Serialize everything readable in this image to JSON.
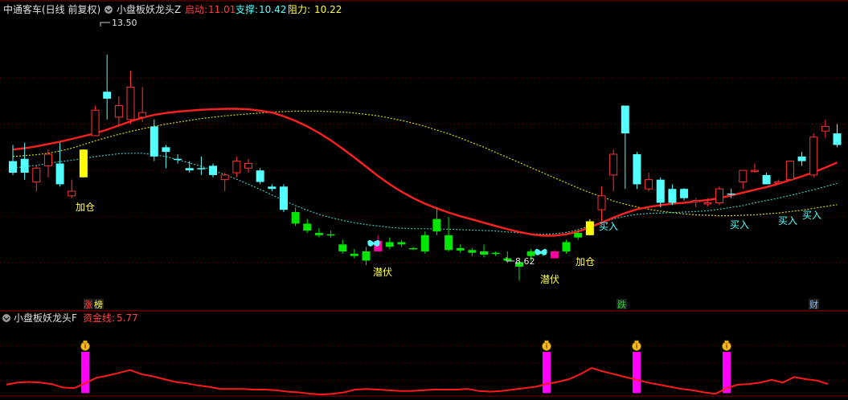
{
  "header": {
    "stock_name": "中通客车(日线 前复权)",
    "indicator_name": "小盘板妖龙头Z",
    "start_label": "启动:",
    "start_value": "11.01",
    "support_label": "支撑:",
    "support_value": "10.42",
    "resistance_label": "阻力:",
    "resistance_value": "10.22"
  },
  "lower_header": {
    "indicator_name": "小盘板妖龙头F",
    "capital_label": "资金线:",
    "capital_value": "5.77"
  },
  "markers": {
    "high_label": "13.50",
    "low_label": "8.62",
    "tag_zhangting_1": "涨",
    "tag_zhangting_2": "榜",
    "tag_die": "跌",
    "tag_cai": "财"
  },
  "signals": {
    "jiacang_1": "加仓",
    "jiacang_2": "加仓",
    "qianfu_1": "潜伏",
    "qianfu_2": "潜伏",
    "mairu_1": "买入",
    "mairu_2": "买入",
    "mairu_3": "买入",
    "mairu_4": "买入"
  },
  "colors": {
    "background": "#000000",
    "up": "#ff3232",
    "down_cyan": "#54ffff",
    "down_green": "#00e600",
    "signal_yellow": "#ffff00",
    "signal_magenta": "#ff00a0",
    "ma_red": "#ff2020",
    "ma_yellow_dotted": "#d8d800",
    "ma_cyan_dotted": "#40c0c0",
    "capital_line": "#ff1a1a",
    "capital_bar": "#ff00ff",
    "grid": "#800000",
    "label_yellow": "#ffff40",
    "label_cyan": "#54ffff"
  },
  "chart_data": [
    {
      "type": "candlestick",
      "title": "小盘板妖龙头Z",
      "ylim": [
        8.0,
        14.3
      ],
      "candles": [
        {
          "o": 11.2,
          "h": 11.55,
          "l": 10.9,
          "c": 10.95,
          "s": "cyan"
        },
        {
          "o": 10.95,
          "h": 11.6,
          "l": 10.8,
          "c": 11.25,
          "s": "cyan"
        },
        {
          "o": 10.75,
          "h": 11.1,
          "l": 10.55,
          "c": 11.05,
          "s": "red"
        },
        {
          "o": 11.1,
          "h": 11.45,
          "l": 10.85,
          "c": 11.35,
          "s": "red"
        },
        {
          "o": 11.15,
          "h": 11.6,
          "l": 10.65,
          "c": 10.7,
          "s": "cyan"
        },
        {
          "o": 10.55,
          "h": 10.8,
          "l": 10.4,
          "c": 10.45,
          "s": "red"
        },
        {
          "o": 10.85,
          "h": 11.45,
          "l": 10.85,
          "c": 11.45,
          "s": "yellow"
        },
        {
          "o": 11.75,
          "h": 12.4,
          "l": 11.75,
          "c": 12.3,
          "s": "red"
        },
        {
          "o": 12.7,
          "h": 13.5,
          "l": 12.1,
          "c": 12.55,
          "s": "cyan"
        },
        {
          "o": 12.15,
          "h": 12.6,
          "l": 11.95,
          "c": 12.4,
          "s": "red"
        },
        {
          "o": 12.1,
          "h": 13.15,
          "l": 12.0,
          "c": 12.8,
          "s": "red"
        },
        {
          "o": 12.15,
          "h": 12.8,
          "l": 12.05,
          "c": 12.25,
          "s": "red"
        },
        {
          "o": 11.95,
          "h": 12.1,
          "l": 11.2,
          "c": 11.3,
          "s": "cyan"
        },
        {
          "o": 11.5,
          "h": 11.55,
          "l": 11.05,
          "c": 11.4,
          "s": "cyan"
        },
        {
          "o": 11.25,
          "h": 11.35,
          "l": 11.15,
          "c": 11.25,
          "s": "cyan"
        },
        {
          "o": 11.05,
          "h": 11.2,
          "l": 10.95,
          "c": 11.0,
          "s": "cyan"
        },
        {
          "o": 11.05,
          "h": 11.3,
          "l": 10.9,
          "c": 11.05,
          "s": "cyan"
        },
        {
          "o": 11.1,
          "h": 11.15,
          "l": 10.85,
          "c": 10.9,
          "s": "cyan"
        },
        {
          "o": 10.8,
          "h": 10.95,
          "l": 10.55,
          "c": 10.9,
          "s": "red"
        },
        {
          "o": 10.95,
          "h": 11.3,
          "l": 10.85,
          "c": 11.2,
          "s": "red"
        },
        {
          "o": 11.05,
          "h": 11.25,
          "l": 10.95,
          "c": 11.15,
          "s": "red"
        },
        {
          "o": 11.0,
          "h": 11.05,
          "l": 10.7,
          "c": 10.75,
          "s": "cyan"
        },
        {
          "o": 10.65,
          "h": 10.7,
          "l": 10.55,
          "c": 10.6,
          "s": "cyan"
        },
        {
          "o": 10.65,
          "h": 10.7,
          "l": 10.1,
          "c": 10.15,
          "s": "cyan"
        },
        {
          "o": 10.1,
          "h": 10.2,
          "l": 9.8,
          "c": 9.85,
          "s": "green"
        },
        {
          "o": 9.85,
          "h": 9.95,
          "l": 9.65,
          "c": 9.7,
          "s": "green"
        },
        {
          "o": 9.65,
          "h": 9.75,
          "l": 9.55,
          "c": 9.6,
          "s": "green"
        },
        {
          "o": 9.6,
          "h": 9.7,
          "l": 9.55,
          "c": 9.62,
          "s": "green"
        },
        {
          "o": 9.4,
          "h": 9.5,
          "l": 9.2,
          "c": 9.25,
          "s": "green"
        },
        {
          "o": 9.2,
          "h": 9.3,
          "l": 9.1,
          "c": 9.15,
          "s": "green"
        },
        {
          "o": 9.25,
          "h": 9.35,
          "l": 8.95,
          "c": 9.05,
          "s": "green"
        },
        {
          "o": 9.25,
          "h": 9.6,
          "l": 9.25,
          "c": 9.48,
          "s": "magenta"
        },
        {
          "o": 9.45,
          "h": 9.55,
          "l": 9.3,
          "c": 9.35,
          "s": "green"
        },
        {
          "o": 9.4,
          "h": 9.5,
          "l": 9.35,
          "c": 9.45,
          "s": "green"
        },
        {
          "o": 9.32,
          "h": 9.35,
          "l": 9.28,
          "c": 9.32,
          "s": "green"
        },
        {
          "o": 9.6,
          "h": 9.68,
          "l": 9.2,
          "c": 9.25,
          "s": "green"
        },
        {
          "o": 9.95,
          "h": 10.2,
          "l": 9.6,
          "c": 9.68,
          "s": "green"
        },
        {
          "o": 9.6,
          "h": 10.0,
          "l": 9.25,
          "c": 9.28,
          "s": "green"
        },
        {
          "o": 9.32,
          "h": 9.4,
          "l": 9.22,
          "c": 9.27,
          "s": "green"
        },
        {
          "o": 9.28,
          "h": 9.32,
          "l": 9.15,
          "c": 9.22,
          "s": "green"
        },
        {
          "o": 9.25,
          "h": 9.4,
          "l": 9.12,
          "c": 9.18,
          "s": "green"
        },
        {
          "o": 9.22,
          "h": 9.25,
          "l": 9.15,
          "c": 9.2,
          "s": "green"
        },
        {
          "o": 9.1,
          "h": 9.25,
          "l": 9.0,
          "c": 9.05,
          "s": "green"
        },
        {
          "o": 9.02,
          "h": 9.05,
          "l": 8.62,
          "c": 8.92,
          "s": "green"
        },
        {
          "o": 9.15,
          "h": 9.3,
          "l": 9.05,
          "c": 9.25,
          "s": "green"
        },
        {
          "o": 9.2,
          "h": 9.28,
          "l": 9.15,
          "c": 9.22,
          "s": "green"
        },
        {
          "o": 9.1,
          "h": 9.28,
          "l": 9.1,
          "c": 9.25,
          "s": "magenta"
        },
        {
          "o": 9.25,
          "h": 9.5,
          "l": 9.2,
          "c": 9.45,
          "s": "green"
        },
        {
          "o": 9.55,
          "h": 9.7,
          "l": 9.5,
          "c": 9.65,
          "s": "green"
        },
        {
          "o": 9.6,
          "h": 9.95,
          "l": 9.6,
          "c": 9.9,
          "s": "yellow"
        },
        {
          "o": 10.15,
          "h": 10.65,
          "l": 9.9,
          "c": 10.45,
          "s": "red"
        },
        {
          "o": 10.9,
          "h": 11.45,
          "l": 10.55,
          "c": 11.35,
          "s": "red"
        },
        {
          "o": 11.8,
          "h": 12.4,
          "l": 10.6,
          "c": 12.4,
          "s": "cyan"
        },
        {
          "o": 11.35,
          "h": 11.4,
          "l": 10.6,
          "c": 10.7,
          "s": "cyan"
        },
        {
          "o": 10.6,
          "h": 10.95,
          "l": 10.55,
          "c": 10.8,
          "s": "red"
        },
        {
          "o": 10.8,
          "h": 10.85,
          "l": 10.2,
          "c": 10.3,
          "s": "cyan"
        },
        {
          "o": 10.6,
          "h": 10.7,
          "l": 10.25,
          "c": 10.3,
          "s": "cyan"
        },
        {
          "o": 10.6,
          "h": 10.62,
          "l": 10.35,
          "c": 10.4,
          "s": "cyan"
        },
        {
          "o": 10.35,
          "h": 10.4,
          "l": 10.2,
          "c": 10.35,
          "s": "red"
        },
        {
          "o": 10.28,
          "h": 10.4,
          "l": 10.22,
          "c": 10.3,
          "s": "red"
        },
        {
          "o": 10.3,
          "h": 10.65,
          "l": 10.25,
          "c": 10.6,
          "s": "red"
        },
        {
          "o": 10.5,
          "h": 10.6,
          "l": 10.4,
          "c": 10.5,
          "s": "cyan"
        },
        {
          "o": 10.75,
          "h": 11.0,
          "l": 10.6,
          "c": 11.0,
          "s": "red"
        },
        {
          "o": 11.0,
          "h": 11.15,
          "l": 10.95,
          "c": 11.0,
          "s": "red"
        },
        {
          "o": 10.7,
          "h": 10.95,
          "l": 10.7,
          "c": 10.9,
          "s": "cyan"
        },
        {
          "o": 10.75,
          "h": 10.8,
          "l": 10.7,
          "c": 10.75,
          "s": "red"
        },
        {
          "o": 10.8,
          "h": 11.2,
          "l": 10.8,
          "c": 11.2,
          "s": "red"
        },
        {
          "o": 11.3,
          "h": 11.4,
          "l": 11.1,
          "c": 11.2,
          "s": "cyan"
        },
        {
          "o": 10.9,
          "h": 11.8,
          "l": 10.85,
          "c": 11.72,
          "s": "red"
        },
        {
          "o": 11.95,
          "h": 12.1,
          "l": 11.7,
          "c": 11.85,
          "s": "red"
        },
        {
          "o": 11.8,
          "h": 12.0,
          "l": 11.5,
          "c": 11.55,
          "s": "cyan"
        }
      ],
      "ma_red": [
        11.45,
        11.48,
        11.52,
        11.57,
        11.62,
        11.68,
        11.74,
        11.8,
        11.88,
        11.97,
        12.06,
        12.14,
        12.2,
        12.24,
        12.27,
        12.29,
        12.31,
        12.32,
        12.33,
        12.33,
        12.32,
        12.29,
        12.25,
        12.17,
        12.07,
        11.95,
        11.81,
        11.65,
        11.47,
        11.28,
        11.08,
        10.88,
        10.7,
        10.54,
        10.4,
        10.28,
        10.18,
        10.09,
        10.01,
        9.94,
        9.87,
        9.8,
        9.73,
        9.67,
        9.62,
        9.59,
        9.59,
        9.62,
        9.68,
        9.77,
        9.87,
        9.98,
        10.08,
        10.16,
        10.21,
        10.25,
        10.28,
        10.3,
        10.33,
        10.36,
        10.4,
        10.46,
        10.52,
        10.58,
        10.64,
        10.71,
        10.79,
        10.87,
        10.96,
        11.06,
        11.17
      ],
      "ma_yellow": [
        11.3,
        11.32,
        11.34,
        11.37,
        11.42,
        11.48,
        11.56,
        11.64,
        11.71,
        11.78,
        11.84,
        11.9,
        11.95,
        12.0,
        12.04,
        12.08,
        12.12,
        12.15,
        12.18,
        12.2,
        12.22,
        12.24,
        12.26,
        12.27,
        12.28,
        12.28,
        12.28,
        12.27,
        12.26,
        12.24,
        12.21,
        12.18,
        12.13,
        12.08,
        12.02,
        11.95,
        11.87,
        11.79,
        11.7,
        11.6,
        11.5,
        11.39,
        11.28,
        11.17,
        11.06,
        10.95,
        10.84,
        10.73,
        10.62,
        10.52,
        10.43,
        10.34,
        10.27,
        10.21,
        10.16,
        10.12,
        10.09,
        10.06,
        10.04,
        10.03,
        10.02,
        10.02,
        10.03,
        10.04,
        10.06,
        10.08,
        10.11,
        10.14,
        10.18,
        10.22,
        10.26
      ],
      "ma_cyan": [
        11.05,
        11.08,
        11.11,
        11.15,
        11.19,
        11.22,
        11.26,
        11.3,
        11.33,
        11.36,
        11.37,
        11.37,
        11.34,
        11.3,
        11.23,
        11.16,
        11.09,
        11.0,
        10.91,
        10.81,
        10.7,
        10.59,
        10.47,
        10.35,
        10.24,
        10.14,
        10.05,
        9.98,
        9.92,
        9.87,
        9.83,
        9.8,
        9.77,
        9.75,
        9.74,
        9.74,
        9.73,
        9.73,
        9.72,
        9.71,
        9.7,
        9.69,
        9.67,
        9.65,
        9.63,
        9.62,
        9.63,
        9.66,
        9.72,
        9.8,
        9.88,
        9.95,
        10.01,
        10.05,
        10.07,
        10.08,
        10.09,
        10.1,
        10.11,
        10.13,
        10.16,
        10.2,
        10.24,
        10.3,
        10.35,
        10.4,
        10.46,
        10.52,
        10.58,
        10.65,
        10.72
      ]
    },
    {
      "type": "line",
      "title": "小盘板妖龙头F",
      "series_name": "资金线",
      "ylim": [
        0,
        10
      ],
      "values": [
        1.5,
        1.8,
        1.9,
        1.8,
        1.6,
        1.1,
        1.0,
        1.7,
        2.5,
        2.8,
        3.2,
        3.6,
        3.0,
        2.7,
        2.3,
        1.9,
        1.7,
        1.4,
        1.2,
        0.9,
        0.9,
        0.9,
        0.8,
        0.8,
        0.7,
        0.5,
        0.4,
        0.2,
        0.1,
        0.2,
        0.4,
        0.8,
        0.9,
        0.8,
        0.7,
        0.6,
        0.6,
        0.7,
        0.8,
        0.8,
        0.8,
        0.9,
        0.6,
        0.5,
        0.6,
        0.8,
        1.0,
        1.2,
        1.6,
        1.9,
        2.3,
        3.0,
        3.9,
        3.4,
        3.0,
        2.6,
        2.2,
        1.8,
        1.5,
        1.2,
        0.9,
        0.7,
        0.4,
        0.2,
        1.0,
        1.5,
        1.6,
        1.8,
        2.2,
        1.8,
        2.6,
        2.3,
        2.1,
        1.6
      ],
      "bars_at": [
        7,
        48,
        56,
        64
      ],
      "bar_value": 6.2
    }
  ]
}
